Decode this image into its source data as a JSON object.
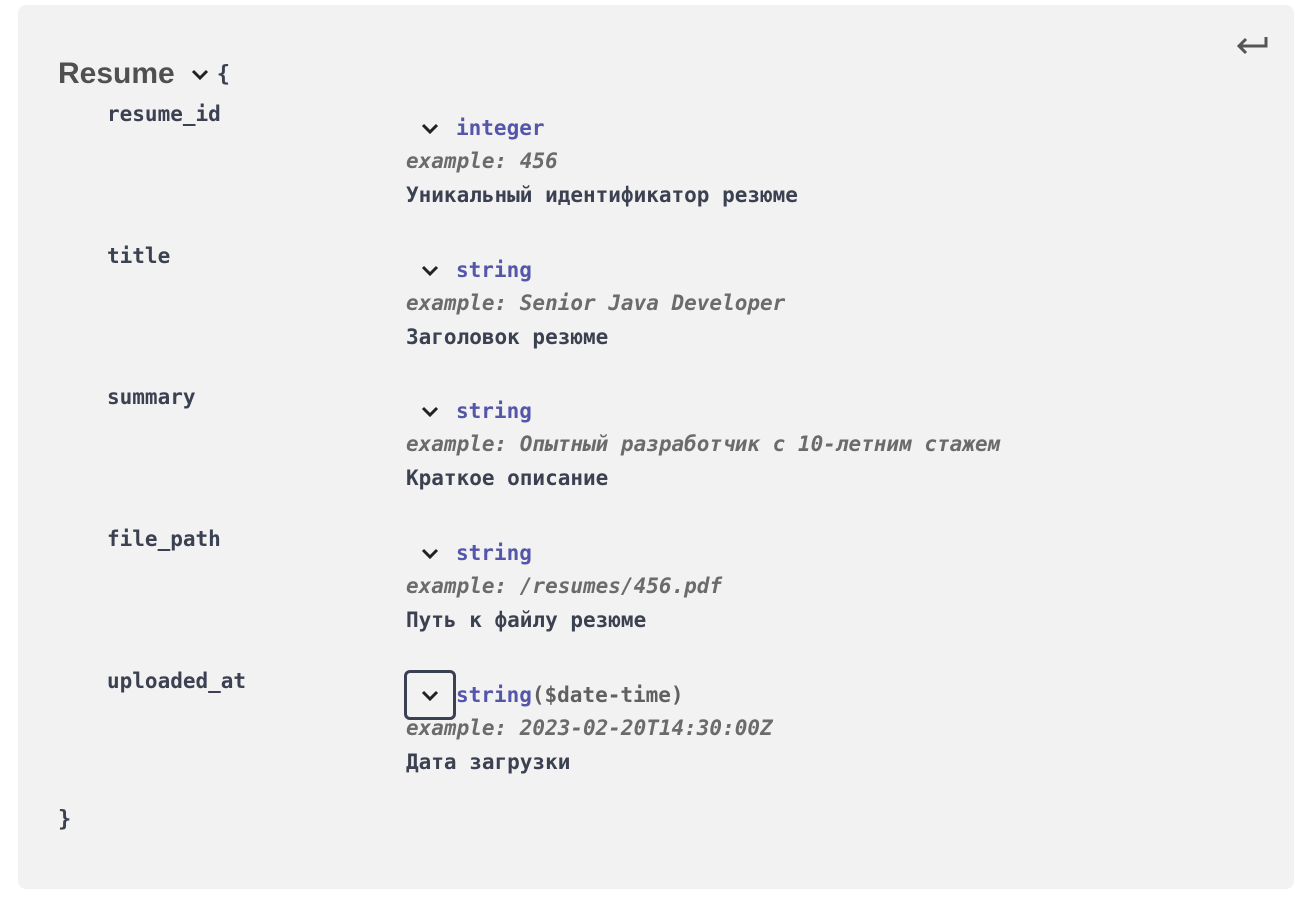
{
  "model": {
    "title": "Resume",
    "open_brace": "{",
    "close_brace": "}"
  },
  "properties": [
    {
      "name": "resume_id",
      "type": "integer",
      "format": "",
      "example": "example: 456",
      "description": "Уникальный идентификатор резюме"
    },
    {
      "name": "title",
      "type": "string",
      "format": "",
      "example": "example: Senior Java Developer",
      "description": "Заголовок резюме"
    },
    {
      "name": "summary",
      "type": "string",
      "format": "",
      "example": "example: Опытный разработчик с 10-летним стажем",
      "description": "Краткое описание"
    },
    {
      "name": "file_path",
      "type": "string",
      "format": "",
      "example": "example: /resumes/456.pdf",
      "description": "Путь к файлу резюме"
    },
    {
      "name": "uploaded_at",
      "type": "string",
      "format": "($date-time)",
      "example": "example: 2023-02-20T14:30:00Z",
      "description": "Дата загрузки"
    }
  ],
  "icons": {
    "collapse": "return-arrow-icon",
    "expand": "chevron-down-icon"
  },
  "colors": {
    "type": "#55a",
    "text": "#3b4151",
    "background": "#f2f2f2"
  }
}
